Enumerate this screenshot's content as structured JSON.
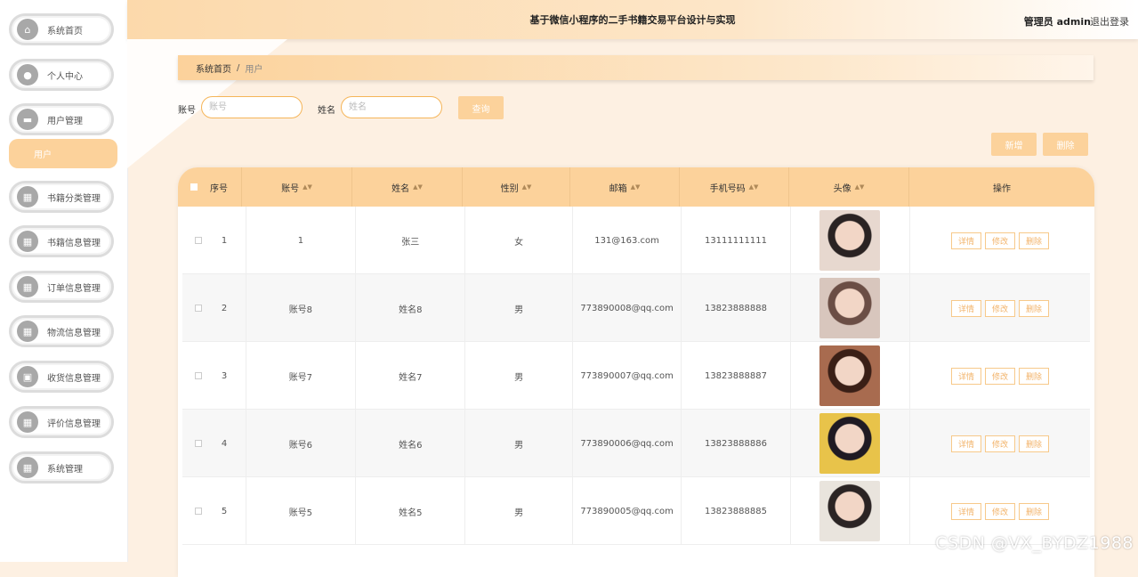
{
  "header": {
    "title": "基于微信小程序的二手书籍交易平台设计与实现",
    "user": "管理员 admin",
    "logout": "退出登录"
  },
  "sidebar": {
    "items": [
      {
        "label": "系统首页",
        "icon": "home-icon"
      },
      {
        "label": "个人中心",
        "icon": "person-icon"
      },
      {
        "label": "用户管理",
        "icon": "chat-icon"
      },
      {
        "label": "书籍分类管理",
        "icon": "grid-icon"
      },
      {
        "label": "书籍信息管理",
        "icon": "grid-icon"
      },
      {
        "label": "订单信息管理",
        "icon": "grid-icon"
      },
      {
        "label": "物流信息管理",
        "icon": "grid-icon"
      },
      {
        "label": "收货信息管理",
        "icon": "briefcase-icon"
      },
      {
        "label": "评价信息管理",
        "icon": "grid-icon"
      },
      {
        "label": "系统管理",
        "icon": "grid-icon"
      }
    ],
    "sub_item": "用户"
  },
  "breadcrumb": {
    "home": "系统首页",
    "separator": "/",
    "current": "用户"
  },
  "search": {
    "account_label": "账号",
    "account_placeholder": "账号",
    "name_label": "姓名",
    "name_placeholder": "姓名",
    "query_button": "查询"
  },
  "actions": {
    "add": "新增",
    "delete": "删除"
  },
  "table": {
    "columns": [
      "序号",
      "账号",
      "姓名",
      "性别",
      "邮箱",
      "手机号码",
      "头像",
      "操作"
    ],
    "rows": [
      {
        "no": "1",
        "account": "1",
        "name": "张三",
        "gender": "女",
        "email": "131@163.com",
        "phone": "13111111111"
      },
      {
        "no": "2",
        "account": "账号8",
        "name": "姓名8",
        "gender": "男",
        "email": "773890008@qq.com",
        "phone": "13823888888"
      },
      {
        "no": "3",
        "account": "账号7",
        "name": "姓名7",
        "gender": "男",
        "email": "773890007@qq.com",
        "phone": "13823888887"
      },
      {
        "no": "4",
        "account": "账号6",
        "name": "姓名6",
        "gender": "男",
        "email": "773890006@qq.com",
        "phone": "13823888886"
      },
      {
        "no": "5",
        "account": "账号5",
        "name": "姓名5",
        "gender": "男",
        "email": "773890005@qq.com",
        "phone": "13823888885"
      }
    ],
    "row_buttons": {
      "detail": "详情",
      "edit": "修改",
      "delete": "删除"
    }
  },
  "colors": {
    "accent": "#fcd29b",
    "outline": "#f5b559"
  },
  "watermark": "CSDN @VX_BYDZ1988"
}
